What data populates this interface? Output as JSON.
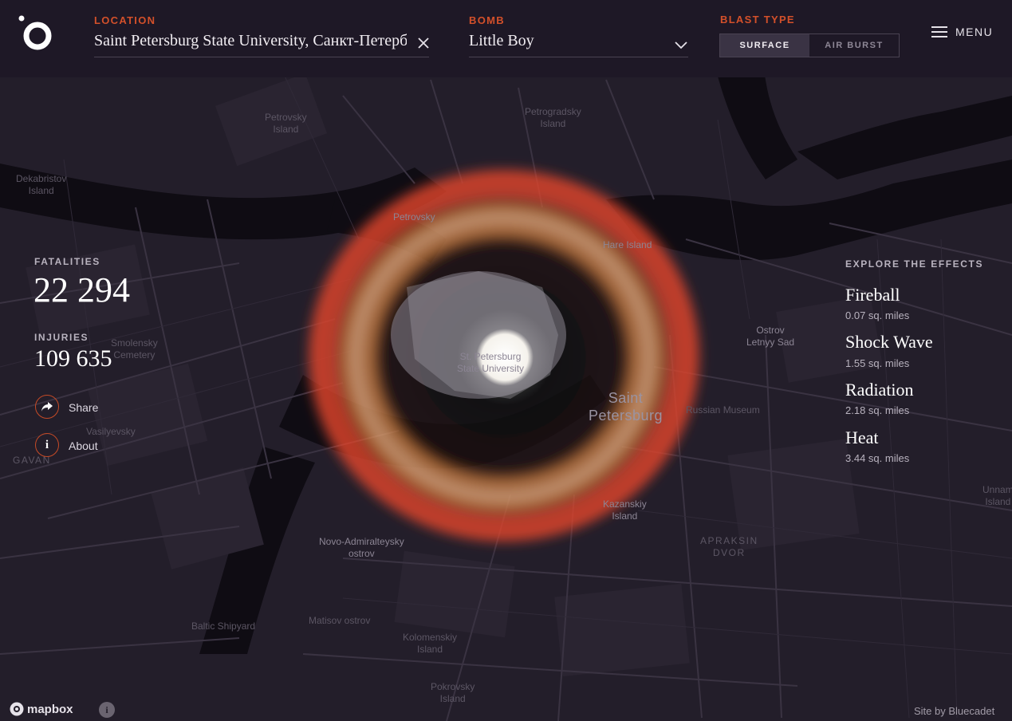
{
  "header": {
    "location_label": "LOCATION",
    "location_value": "Saint Petersburg State University, Санкт-Петербург",
    "bomb_label": "BOMB",
    "bomb_value": "Little Boy",
    "blast_label": "BLAST TYPE",
    "blast_options": [
      "SURFACE",
      "AIR BURST"
    ],
    "blast_selected": "SURFACE",
    "menu_label": "MENU"
  },
  "stats": {
    "fatalities_label": "FATALITIES",
    "fatalities_value": "22 294",
    "injuries_label": "INJURIES",
    "injuries_value": "109 635"
  },
  "actions": {
    "share_label": "Share",
    "about_label": "About",
    "about_icon": "i"
  },
  "effects": {
    "title": "EXPLORE THE EFFECTS",
    "items": [
      {
        "name": "Fireball",
        "area": "0.07 sq. miles"
      },
      {
        "name": "Shock Wave",
        "area": "1.55 sq. miles"
      },
      {
        "name": "Radiation",
        "area": "2.18 sq. miles"
      },
      {
        "name": "Heat",
        "area": "3.44 sq. miles"
      }
    ]
  },
  "map": {
    "labels": {
      "petrovsky_island": "Petrovsky\nIsland",
      "petrogradsky_island": "Petrogradsky\nIsland",
      "dekabristov_island": "Dekabristov\nIsland",
      "petrovsky": "Petrovsky",
      "hare_island": "Hare Island",
      "smolensky_cemetery": "Smolensky\nCemetery",
      "st_petersburg_state_university": "St. Petersburg\nState University",
      "saint_petersburg": "Saint\nPetersburg",
      "russian_museum": "Russian Museum",
      "ostrov_letnyy_sad": "Ostrov\nLetnyy Sad",
      "vasilyevsky": "Vasilyevsky",
      "gavan": "GAVAN",
      "kazanskiy_island": "Kazanskiy\nIsland",
      "apraksin_dvor": "APRAKSIN\nDVOR",
      "novo_admiralteysky_ostrov": "Novo-Admiralteysky\nostrov",
      "baltic_shipyard": "Baltic Shipyard",
      "matisov_ostrov": "Matisov ostrov",
      "kolomenskiy_island": "Kolomenskiy\nIsland",
      "pokrovsky_island": "Pokrovsky\nIsland",
      "unnamed_island": "Unnam\nIsland"
    }
  },
  "footer": {
    "mapbox_label": "mapbox",
    "info_icon": "i",
    "credit": "Site by Bluecadet"
  },
  "colors": {
    "accent": "#d3502a",
    "header_bg": "#1e1826",
    "map_bg": "#231e2a",
    "water": "#0f0c13",
    "heat_ring": "#e0452c",
    "radiation_ring": "#c07a3a",
    "fireball": "#f5f2ec"
  },
  "icons": {
    "logo": "logo-icon",
    "clear": "close-icon",
    "dropdown": "chevron-down-icon",
    "menu": "hamburger-icon",
    "share": "share-arrow-icon",
    "about": "info-icon",
    "mapbox": "mapbox-logo-icon"
  }
}
